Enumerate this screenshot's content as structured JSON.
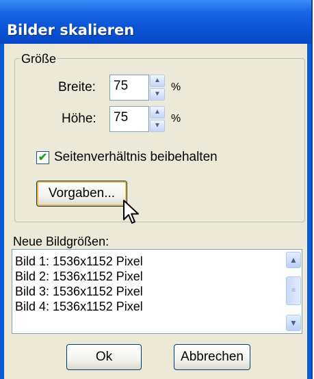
{
  "window": {
    "title": "Bilder skalieren"
  },
  "size_group": {
    "legend": "Größe",
    "width": {
      "label": "Breite:",
      "value": "75",
      "unit": "%"
    },
    "height": {
      "label": "Höhe:",
      "value": "75",
      "unit": "%"
    },
    "keep_aspect": {
      "label": "Seitenverhältnis beibehalten",
      "checked": true
    },
    "presets_button": "Vorgaben..."
  },
  "new_sizes": {
    "label": "Neue Bildgrößen:",
    "items": [
      "Bild 1: 1536x1152 Pixel",
      "Bild 2: 1536x1152 Pixel",
      "Bild 3: 1536x1152 Pixel",
      "Bild 4: 1536x1152 Pixel"
    ]
  },
  "buttons": {
    "ok": "Ok",
    "cancel": "Abbrechen"
  },
  "colors": {
    "titlebar": "#0a5bd8",
    "dialog_face": "#ece9d8",
    "check_mark": "#21a121",
    "focus_ring": "#f8b436"
  }
}
